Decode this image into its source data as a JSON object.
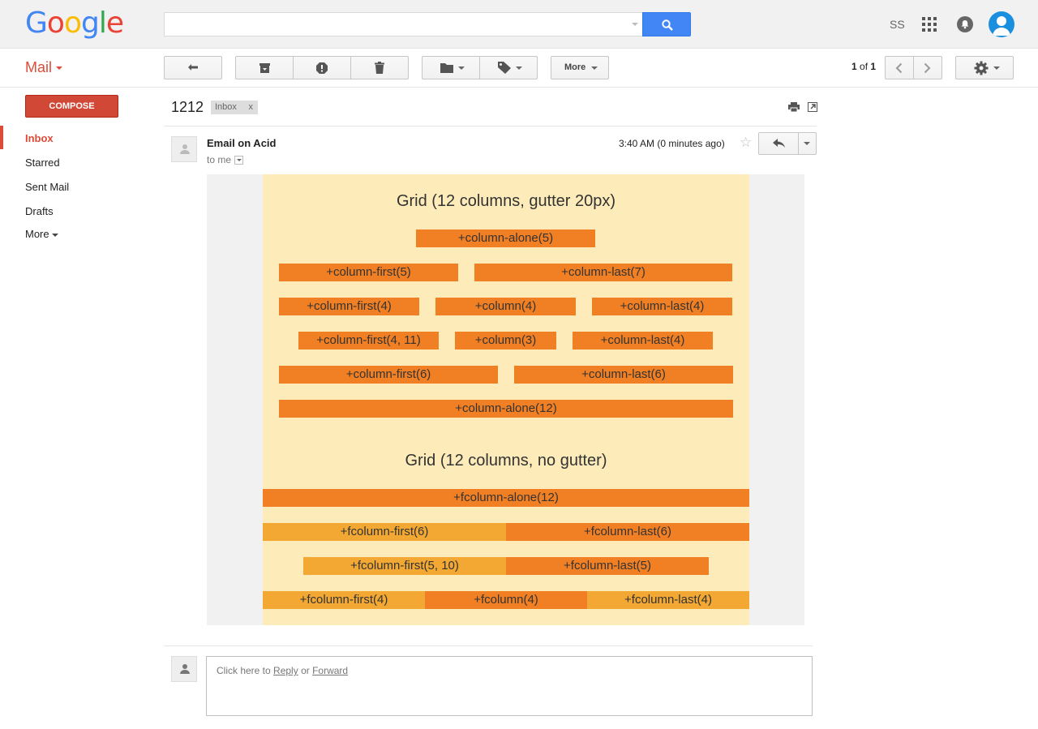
{
  "header": {
    "logo_letters": [
      {
        "ch": "G",
        "color": "#4285f4"
      },
      {
        "ch": "o",
        "color": "#ea4335"
      },
      {
        "ch": "o",
        "color": "#fbbc05"
      },
      {
        "ch": "g",
        "color": "#4285f4"
      },
      {
        "ch": "l",
        "color": "#34a853"
      },
      {
        "ch": "e",
        "color": "#ea4335"
      }
    ],
    "search_value": "",
    "user_initials": "SS"
  },
  "toolbar": {
    "app_label": "Mail",
    "more_label": "More",
    "page_current": "1",
    "page_of": "of",
    "page_total": "1"
  },
  "sidebar": {
    "compose_label": "COMPOSE",
    "items": [
      {
        "label": "Inbox",
        "active": true
      },
      {
        "label": "Starred"
      },
      {
        "label": "Sent Mail"
      },
      {
        "label": "Drafts"
      },
      {
        "label": "More"
      }
    ]
  },
  "message": {
    "subject": "1212",
    "label_badge": "Inbox",
    "label_remove": "x",
    "sender": "Email on Acid",
    "recipient": "to me",
    "timestamp": "3:40 AM (0 minutes ago)",
    "star_icon": "☆"
  },
  "email_body": {
    "sections": [
      {
        "title": "Grid (12 columns, gutter 20px)",
        "rows": [
          [
            {
              "label": "+column-alone(5)",
              "shade": "dark"
            }
          ],
          [
            {
              "label": "+column-first(5)",
              "shade": "dark"
            },
            {
              "label": "+column-last(7)",
              "shade": "dark"
            }
          ],
          [
            {
              "label": "+column-first(4)",
              "shade": "dark"
            },
            {
              "label": "+column(4)",
              "shade": "dark"
            },
            {
              "label": "+column-last(4)",
              "shade": "dark"
            }
          ],
          [
            {
              "label": "+column-first(4, 11)",
              "shade": "dark"
            },
            {
              "label": "+column(3)",
              "shade": "dark"
            },
            {
              "label": "+column-last(4)",
              "shade": "dark"
            }
          ],
          [
            {
              "label": "+column-first(6)",
              "shade": "dark"
            },
            {
              "label": "+column-last(6)",
              "shade": "dark"
            }
          ],
          [
            {
              "label": "+column-alone(12)",
              "shade": "dark"
            }
          ]
        ]
      },
      {
        "title": "Grid (12 columns, no gutter)",
        "rows": [
          [
            {
              "label": "+fcolumn-alone(12)",
              "shade": "dark"
            }
          ],
          [
            {
              "label": "+fcolumn-first(6)",
              "shade": "light"
            },
            {
              "label": "+fcolumn-last(6)",
              "shade": "dark"
            }
          ],
          [
            {
              "label": "+fcolumn-first(5, 10)",
              "shade": "light"
            },
            {
              "label": "+fcolumn-last(5)",
              "shade": "dark"
            }
          ],
          [
            {
              "label": "+fcolumn-first(4)",
              "shade": "light"
            },
            {
              "label": "+fcolumn(4)",
              "shade": "dark"
            },
            {
              "label": "+fcolumn-last(4)",
              "shade": "light"
            }
          ]
        ]
      }
    ]
  },
  "reply": {
    "prompt_prefix": "Click here to",
    "reply_link": "Reply",
    "or": "or",
    "forward_link": "Forward"
  },
  "colors": {
    "brand_red": "#dd4b39",
    "search_blue": "#4285f4",
    "cell_dark": "#f17f23",
    "cell_light": "#f2a833",
    "email_bg": "#fdebb9"
  }
}
